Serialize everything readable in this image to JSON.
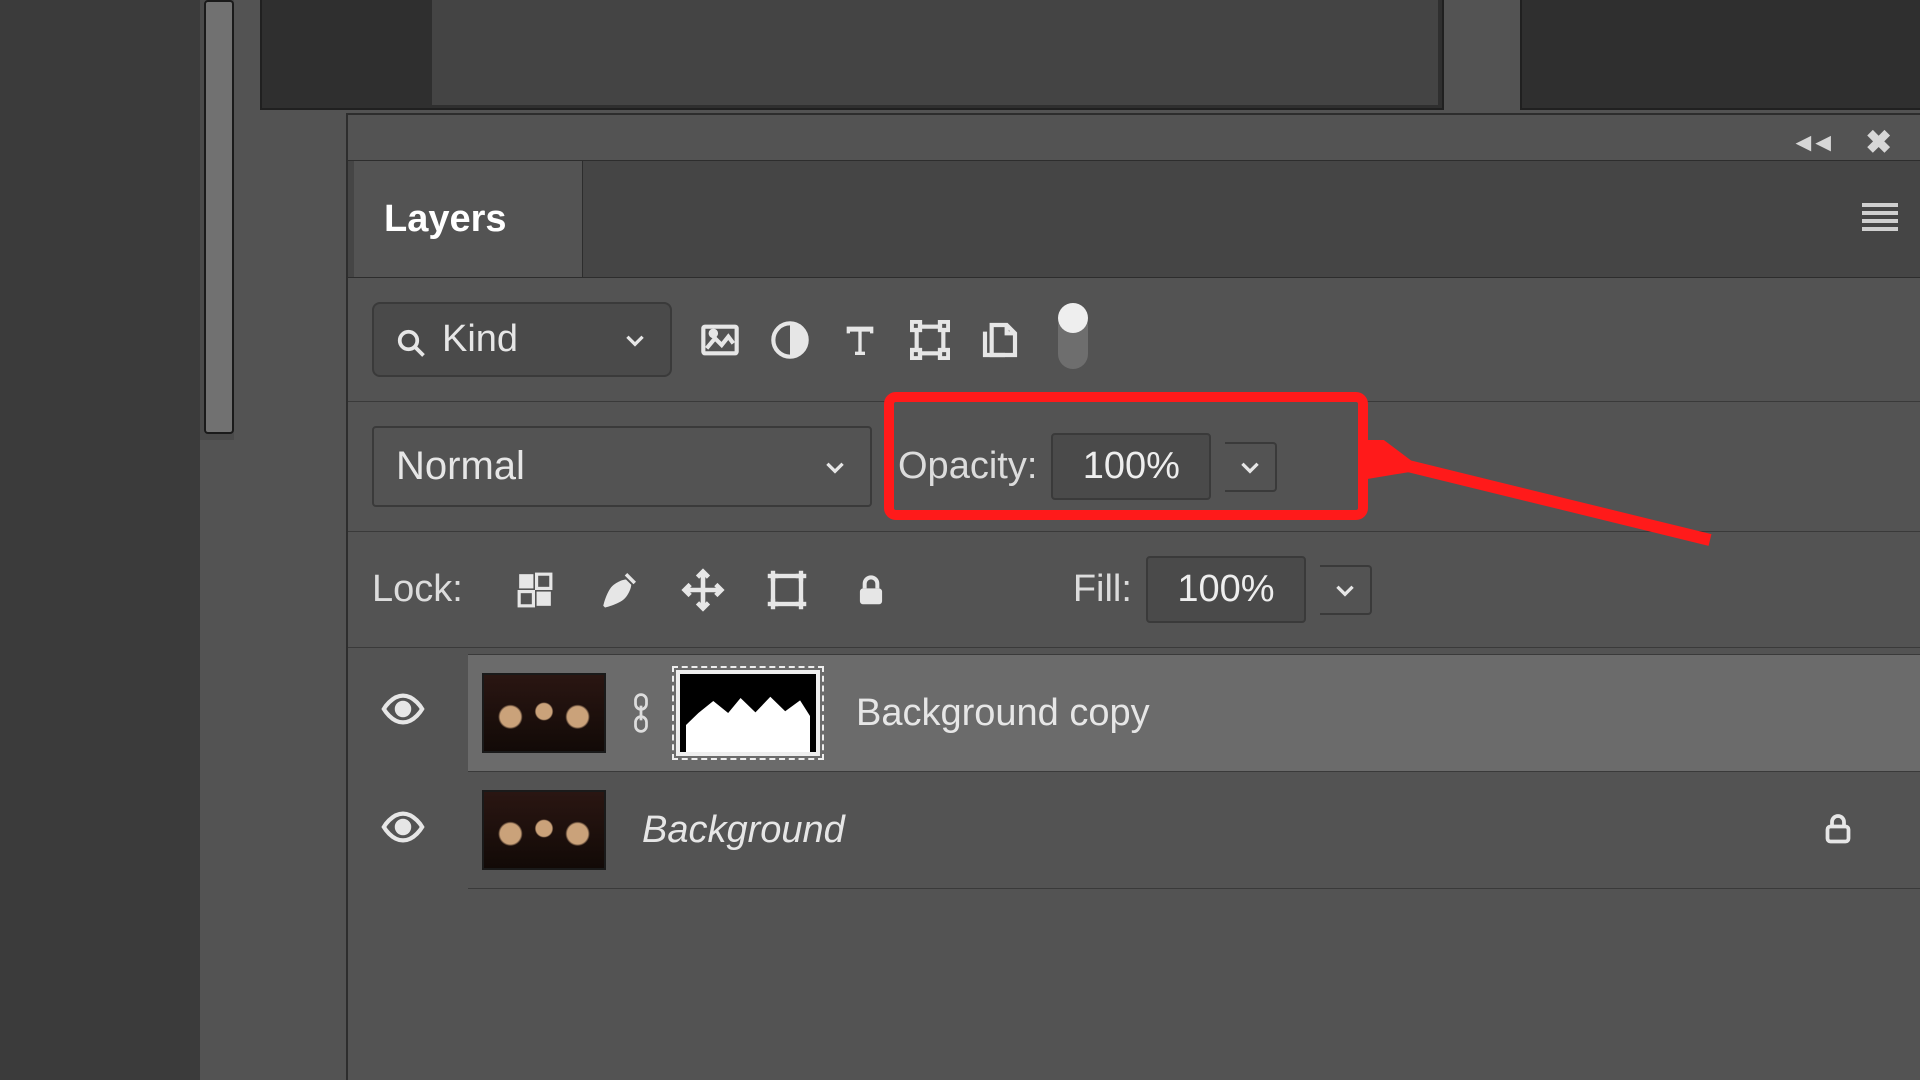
{
  "panel": {
    "tab_label": "Layers"
  },
  "filter": {
    "kind_label": "Kind"
  },
  "blend": {
    "mode": "Normal",
    "opacity_label": "Opacity:",
    "opacity_value": "100%"
  },
  "lock": {
    "label": "Lock:",
    "fill_label": "Fill:",
    "fill_value": "100%"
  },
  "layers": [
    {
      "name": "Background copy",
      "italic": false,
      "selected": true,
      "has_mask": true,
      "locked": false
    },
    {
      "name": "Background",
      "italic": true,
      "selected": false,
      "has_mask": false,
      "locked": true
    }
  ],
  "icons": {
    "image_filter": "image-filter-icon",
    "adjust_filter": "adjust-filter-icon",
    "type_filter": "type-filter-icon",
    "shape_filter": "shape-filter-icon",
    "smart_filter": "smart-filter-icon"
  }
}
